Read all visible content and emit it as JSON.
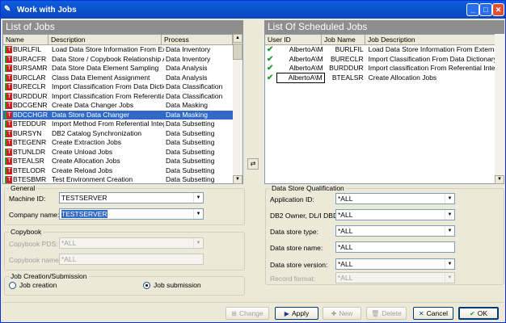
{
  "window": {
    "title": "Work with Jobs"
  },
  "left_panel": {
    "title": "List of Jobs",
    "columns": [
      "Name",
      "Description",
      "Process"
    ],
    "rows": [
      {
        "name": "BURLFIL",
        "description": "Load Data Store Information From Exte...",
        "process": "Data Inventory"
      },
      {
        "name": "BURACFR",
        "description": "Data Store / Copybook Relationship A...",
        "process": "Data Inventory"
      },
      {
        "name": "BURSAMR",
        "description": "Data Store Data Element Sampling",
        "process": "Data Analysis"
      },
      {
        "name": "BURCLAR",
        "description": "Class Data Element Assignment",
        "process": "Data Analysis"
      },
      {
        "name": "BURECLR",
        "description": "Import Classification From Data Diction...",
        "process": "Data Classification"
      },
      {
        "name": "BURDDUR",
        "description": "Import Classification From Referential I...",
        "process": "Data Classification"
      },
      {
        "name": "BDCGENR",
        "description": "Create Data Changer Jobs",
        "process": "Data Masking"
      },
      {
        "name": "BDCCHGR",
        "description": "Data Store Data Changer",
        "process": "Data Masking"
      },
      {
        "name": "BTEDDUR",
        "description": "Import Method From Referential Integrity",
        "process": "Data Subsetting"
      },
      {
        "name": "BURSYN",
        "description": "DB2 Catalog Synchronization",
        "process": "Data Subsetting"
      },
      {
        "name": "BTEGENR",
        "description": "Create Extraction Jobs",
        "process": "Data Subsetting"
      },
      {
        "name": "BTUNLDR",
        "description": "Create Unload Jobs",
        "process": "Data Subsetting"
      },
      {
        "name": "BTEALSR",
        "description": "Create Allocation Jobs",
        "process": "Data Subsetting"
      },
      {
        "name": "BTELODR",
        "description": "Create Reload Jobs",
        "process": "Data Subsetting"
      },
      {
        "name": "BTESBMR",
        "description": "Test Environment Creation",
        "process": "Data Subsetting"
      }
    ],
    "selected_index": 7
  },
  "right_panel": {
    "title": "List Of Scheduled Jobs",
    "columns": [
      "User ID",
      "Job Name",
      "Job Description"
    ],
    "rows": [
      {
        "user": "AlbertoA\\M",
        "job": "BURLFIL",
        "description": "Load Data Store Information From External Interfa"
      },
      {
        "user": "AlbertoA\\M",
        "job": "BURECLR",
        "description": "Import Classification From Data Dictionary"
      },
      {
        "user": "AlbertoA\\M",
        "job": "BURDDUR",
        "description": "Import classification From Referential Integrity"
      },
      {
        "user": "AlbertoA\\M",
        "job": "BTEALSR",
        "description": "Create Allocation Jobs"
      }
    ]
  },
  "general": {
    "label": "General",
    "machine_label": "Machine ID:",
    "machine_value": "TESTSERVER",
    "company_label": "Company name:",
    "company_value": "TESTSERVER"
  },
  "copybook": {
    "label": "Copybook",
    "pds_label": "Copybook PDS:",
    "pds_value": "*ALL",
    "name_label": "Copybook name:",
    "name_value": "*ALL"
  },
  "job_creation": {
    "label": "Job Creation/Submission",
    "opt1": "Job creation",
    "opt2": "Job submission",
    "selected": "Job submission"
  },
  "dsq": {
    "label": "Data Store Qualification",
    "fields": [
      {
        "label": "Application ID:",
        "value": "*ALL"
      },
      {
        "label": "DB2 Owner, DL/I DBD:",
        "value": "*ALL"
      },
      {
        "label": "Data store type:",
        "value": "*ALL"
      },
      {
        "label": "Data store name:",
        "value": "*ALL"
      },
      {
        "label": "Data store version:",
        "value": "*ALL"
      },
      {
        "label": "Record format:",
        "value": "*ALL"
      }
    ]
  },
  "buttons": {
    "change": "Change",
    "apply": "Apply",
    "new": "New",
    "delete": "Delete",
    "cancel": "Cancel",
    "ok": "OK"
  }
}
